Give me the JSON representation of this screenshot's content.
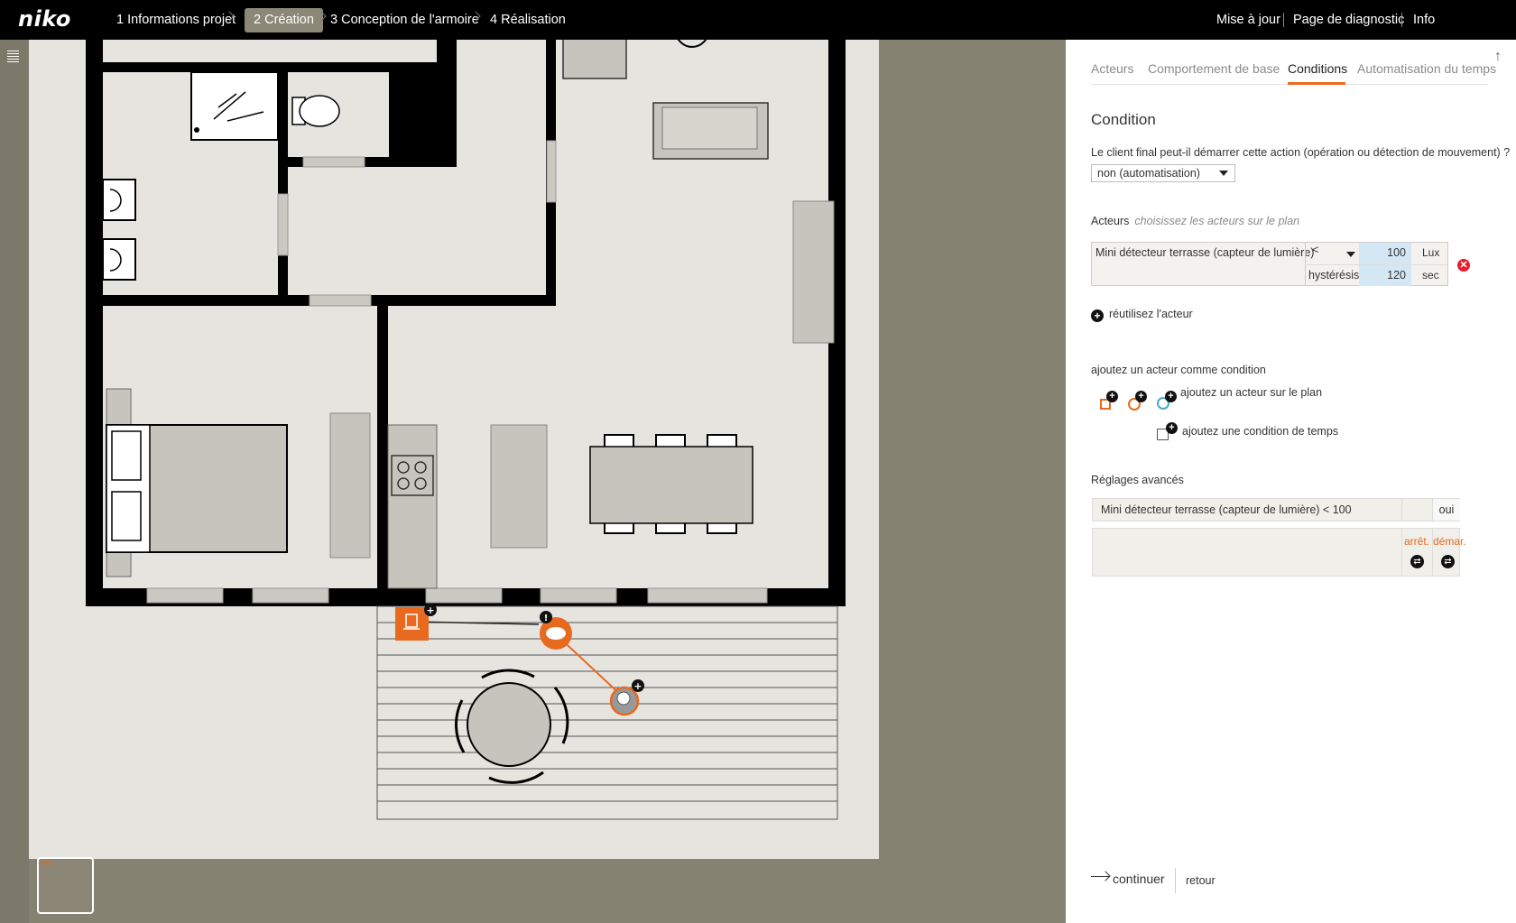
{
  "header": {
    "logo": "niko",
    "steps": [
      {
        "label": "1 Informations projet"
      },
      {
        "label": "2 Création"
      },
      {
        "label": "3 Conception de l'armoire"
      },
      {
        "label": "4 Réalisation"
      }
    ],
    "right_links": [
      {
        "label": "Mise à jour"
      },
      {
        "label": "Page de diagnostic"
      },
      {
        "label": "Info"
      }
    ]
  },
  "tabs": [
    {
      "label": "Acteurs"
    },
    {
      "label": "Comportement de base"
    },
    {
      "label": "Conditions"
    },
    {
      "label": "Automatisation du temps"
    }
  ],
  "condition": {
    "title": "Condition",
    "question": "Le client final peut-il démarrer cette action (opération ou détection de mouvement) ?",
    "select_value": "non (automatisation)"
  },
  "actors": {
    "label": "Acteurs",
    "hint": "choisissez les acteurs sur le plan",
    "rows": [
      {
        "name": "Mini détecteur  terrasse (capteur de lumière)",
        "operator": "<",
        "value": "100",
        "unit": "Lux",
        "hysteresis_label": "hystérésis",
        "hysteresis_value": "120",
        "hysteresis_unit": "sec"
      }
    ],
    "remove_symbol": "✕"
  },
  "reuse_label": "réutilisez l'acteur",
  "add_condition": {
    "title": "ajoutez un acteur comme condition",
    "on_plan_label": "ajoutez un acteur sur le plan",
    "time_label": "ajoutez une condition de temps"
  },
  "advanced": {
    "title": "Réglages avancés",
    "row_text": "Mini détecteur  terrasse (capteur de lumière) < 100",
    "row_value": "oui",
    "stop_label": "arrêt.",
    "start_label": "démar."
  },
  "footer": {
    "continue_label": "continuer",
    "back_label": "retour"
  },
  "colors": {
    "accent": "#e86a1e",
    "topbar": "#000000",
    "background": "#868271",
    "value_highlight": "#d3e8f4",
    "remove": "#e31e2d"
  },
  "icons": {
    "menu": "hamburger-icon",
    "scroll_up": "arrow-up-icon",
    "remove": "remove-circle-icon",
    "add": "plus-circle-icon",
    "swap": "swap-icon"
  }
}
